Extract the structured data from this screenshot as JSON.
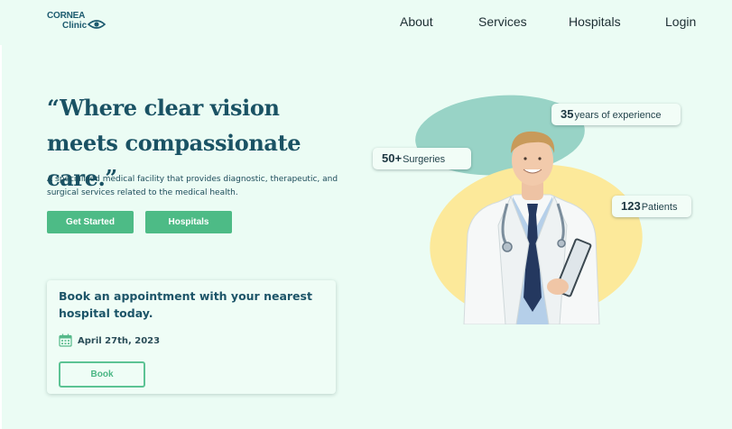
{
  "header": {
    "logo_text_1": "CORNEA",
    "logo_text_2": "Clinic",
    "nav": [
      "About",
      "Services",
      "Hospitals",
      "Login"
    ]
  },
  "hero": {
    "headline": "“Where clear vision meets compassionate care.”",
    "subtext": "A specialized medical facility that provides diagnostic, therapeutic, and surgical services related to the medical health.",
    "buttons": {
      "primary": "Get Started",
      "secondary": "Hospitals"
    }
  },
  "appointment_card": {
    "title": "Book an appointment with your nearest hospital today.",
    "date": "April 27th, 2023",
    "button": "Book"
  },
  "stats": [
    {
      "number": "35",
      "label": "years of experience"
    },
    {
      "number": "50+",
      "label": "Surgeries"
    },
    {
      "number": "123",
      "label": "Patients"
    }
  ],
  "colors": {
    "background": "#ebfcf4",
    "accent": "#4dbb86",
    "heading": "#1a5264",
    "blob_teal": "#98d3c6",
    "blob_yellow": "#fce99a"
  },
  "icons": [
    "eye-icon",
    "calendar-icon"
  ]
}
